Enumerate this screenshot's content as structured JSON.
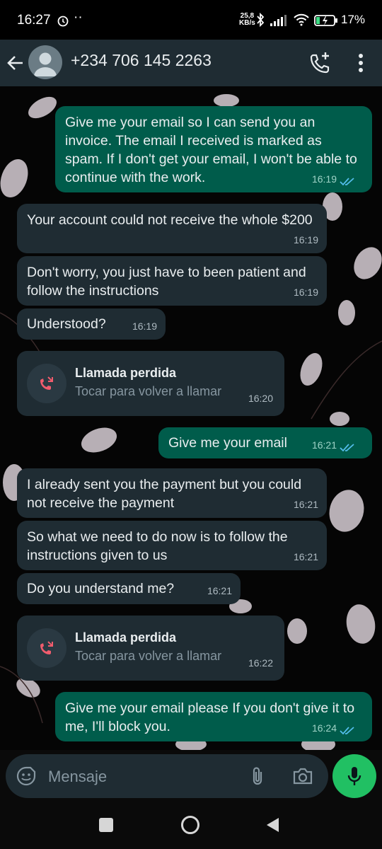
{
  "status_bar": {
    "time": "16:27",
    "net_speed_value": "25,8",
    "net_speed_unit": "KB/s",
    "battery": "17%"
  },
  "header": {
    "contact": "+234 706 145 2263"
  },
  "messages": [
    {
      "dir": "out",
      "text": "Give me your email so I can send you an invoice. The email I received is marked as spam. If I don't get your email, I won't be able to continue with the work.",
      "time": "16:19"
    },
    {
      "dir": "in",
      "text": "Your account could not receive the whole $200",
      "time": "16:19"
    },
    {
      "dir": "in",
      "text": "Don't worry, you just have to been patient and follow the instructions",
      "time": "16:19"
    },
    {
      "dir": "in",
      "text": "Understood?",
      "time": "16:19"
    },
    {
      "dir": "call",
      "title": "Llamada perdida",
      "subtitle": "Tocar para volver a llamar",
      "time": "16:20"
    },
    {
      "dir": "out",
      "text": "Give me your email",
      "time": "16:21"
    },
    {
      "dir": "in",
      "text": "I already sent you the payment but you could not receive the payment",
      "time": "16:21"
    },
    {
      "dir": "in",
      "text": "So what we need to do now is to follow the instructions given to us",
      "time": "16:21"
    },
    {
      "dir": "in",
      "text": "Do you understand me?",
      "time": "16:21"
    },
    {
      "dir": "call",
      "title": "Llamada perdida",
      "subtitle": "Tocar para volver a llamar",
      "time": "16:22"
    },
    {
      "dir": "out",
      "text": "Give me your email please If you don't give it to me, I'll block you.",
      "time": "16:24"
    }
  ],
  "composer": {
    "placeholder": "Mensaje"
  },
  "colors": {
    "outgoing": "#005c4b",
    "incoming": "#1f2c33",
    "accent": "#21c063",
    "missed_call": "#f15c6d"
  }
}
